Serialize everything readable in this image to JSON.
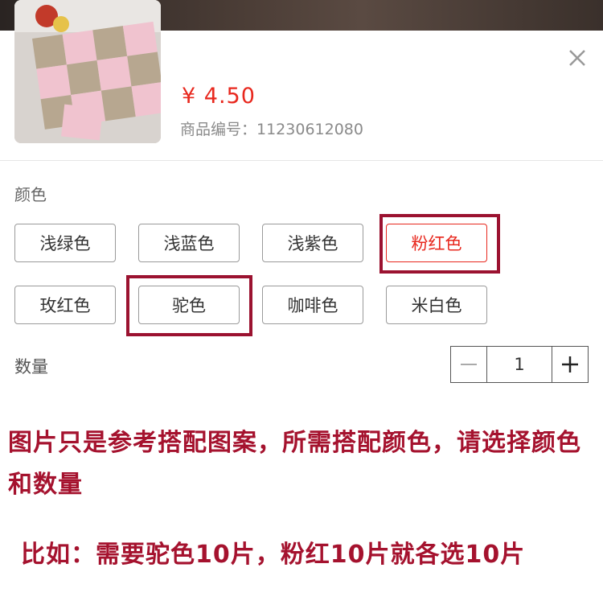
{
  "product": {
    "price": "¥ 4.50",
    "code_label": "商品编号：11230612080"
  },
  "icons": {
    "close": "close-icon",
    "minus": "minus-icon",
    "plus": "plus-icon"
  },
  "colors": {
    "accent": "#e8281e",
    "highlight": "#9b1230",
    "note": "#a5122e"
  },
  "color_section": {
    "label": "颜色",
    "options": [
      "浅绿色",
      "浅蓝色",
      "浅紫色",
      "粉红色",
      "玫红色",
      "驼色",
      "咖啡色",
      "米白色"
    ],
    "selected": "粉红色"
  },
  "quantity": {
    "label": "数量",
    "value": "1"
  },
  "notes": {
    "line1": "图片只是参考搭配图案，所需搭配颜色，请选择颜色和数量",
    "line2": "比如：需要驼色10片，粉红10片就各选10片"
  }
}
